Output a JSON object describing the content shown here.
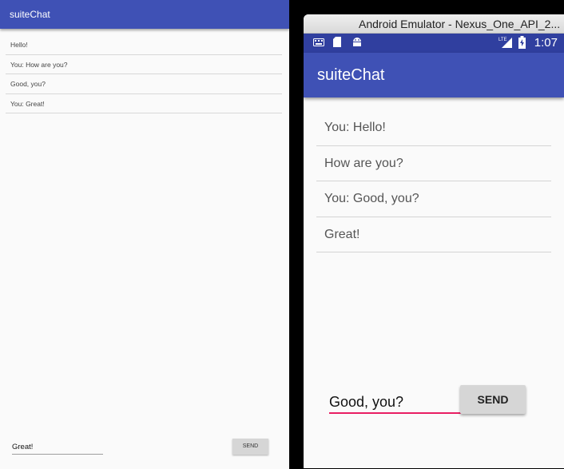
{
  "left": {
    "app_title": "suiteChat",
    "messages": [
      "Hello!",
      "You: How are you?",
      "Good, you?",
      "You: Great!"
    ],
    "input_value": "Great!",
    "send_label": "SEND"
  },
  "right": {
    "window_title": "Android Emulator - Nexus_One_API_2...",
    "status": {
      "time": "1:07",
      "left_icons": [
        "keyboard-icon",
        "sd-card-icon",
        "android-icon"
      ],
      "right_icons": [
        "lte-signal-icon",
        "battery-icon"
      ],
      "lte_text": "LTE"
    },
    "app_title": "suiteChat",
    "messages": [
      "You: Hello!",
      "How are you?",
      "You: Good, you?",
      "Great!"
    ],
    "input_value": "Good, you?",
    "send_label": "SEND"
  },
  "colors": {
    "primary": "#3f51b5",
    "primary_dark": "#303f9f",
    "accent": "#e91e63",
    "background": "#fafafa"
  }
}
